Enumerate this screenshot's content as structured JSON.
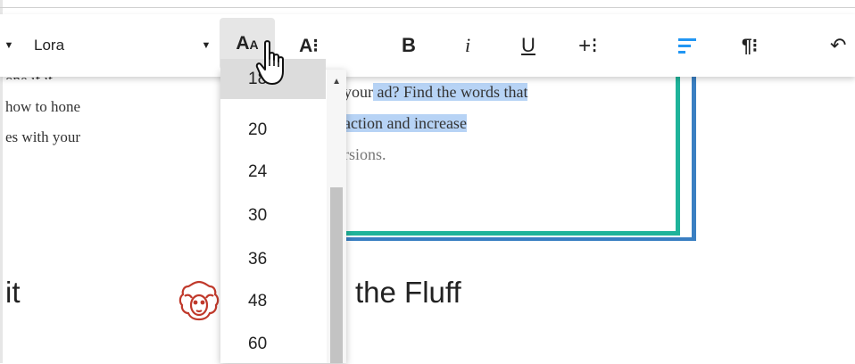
{
  "document": {
    "left_text_lines": [
      "one if it",
      "how to hone",
      "es with your"
    ],
    "heading_left": "it",
    "heading_right": "the Fluff",
    "callout": {
      "line1_plain": "your",
      "line1_highlight": " ad? Find the words that",
      "line2_highlight": " action and increase",
      "line3": "rsions."
    }
  },
  "toolbar": {
    "font_name": "Lora",
    "font_size_label_big": "A",
    "font_size_label_small": "A",
    "text_style_label": "A⁝",
    "bold_label": "B",
    "italic_label": "i",
    "underline_label": "U",
    "insert_label": "+⁝",
    "paragraph_label": "¶⁝",
    "undo_label": "↶"
  },
  "font_size_dropdown": {
    "selected": "18",
    "options": [
      "18",
      "20",
      "24",
      "30",
      "36",
      "48",
      "60"
    ]
  },
  "colors": {
    "highlight": "#b7d3f5",
    "teal_border": "#1fb39a",
    "blue_border": "#3a7fc2",
    "align_icon": "#2196f3",
    "sheep_icon": "#c0392b"
  },
  "icons": {
    "font_size": "font-size-icon",
    "align": "align-left-icon",
    "undo": "undo-icon",
    "pointer": "hand-pointer-icon",
    "sheep": "sheep-icon"
  }
}
